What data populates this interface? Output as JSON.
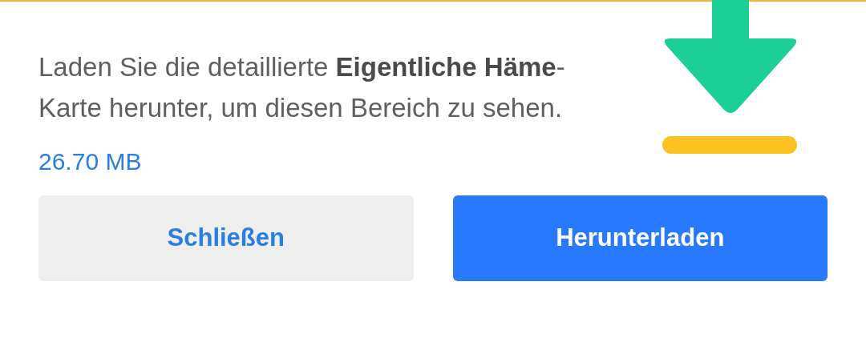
{
  "message": "Laden Sie die detaillierte **Eigentliche Häme**-Karte herunter, um diesen Bereich zu sehen.",
  "size": "26.70 MB",
  "buttons": [
    {
      "label": "Schließen",
      "kind": "secondary"
    },
    {
      "label": "Herunterladen",
      "kind": "primary"
    }
  ]
}
